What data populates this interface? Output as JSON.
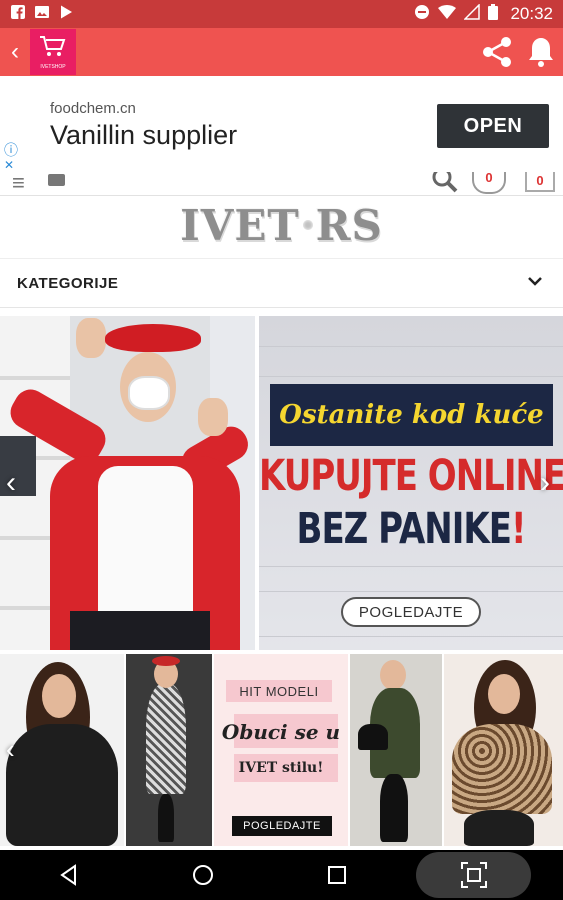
{
  "status_bar": {
    "time": "20:32",
    "left_icons": [
      "facebook-icon",
      "image-icon",
      "play-store-icon"
    ],
    "right_icons": [
      "do-not-disturb-icon",
      "wifi-icon",
      "signal-icon",
      "battery-icon"
    ]
  },
  "app_bar": {
    "back_glyph": "‹",
    "logo_caption": "IVETSHOP",
    "actions": [
      "share-icon",
      "notification-bell-icon"
    ],
    "accent": "#ef5350",
    "status_color": "#c73a3a"
  },
  "ad": {
    "domain": "foodchem.cn",
    "title": "Vanillin supplier",
    "button_label": "OPEN",
    "info_glyph": "ⓘ",
    "close_glyph": "✕"
  },
  "site_header": {
    "wishlist_count": "0",
    "cart_count": "0",
    "brand_left": "IVET",
    "brand_right": "RS"
  },
  "categories": {
    "label": "KATEGORIJE",
    "chevron": "⌄"
  },
  "hero": {
    "banner_tagline": "Ostanite kod kuće",
    "headline_line1": "KUPUJTE ONLINE",
    "headline_line2": "BEZ PANIKE",
    "headline_mark": "!",
    "button_label": "POGLEDAJTE",
    "prev_glyph": "‹",
    "next_glyph": "›"
  },
  "strip": {
    "hit_label": "HIT MODELI",
    "promo_line1": "Obuci se u",
    "promo_line2": "IVET stilu!",
    "button_label": "POGLEDAJTE",
    "prev_glyph": "‹"
  },
  "nav_bar": {
    "buttons": [
      "back-triangle-icon",
      "home-circle-icon",
      "recents-square-icon",
      "screenshot-icon"
    ]
  }
}
